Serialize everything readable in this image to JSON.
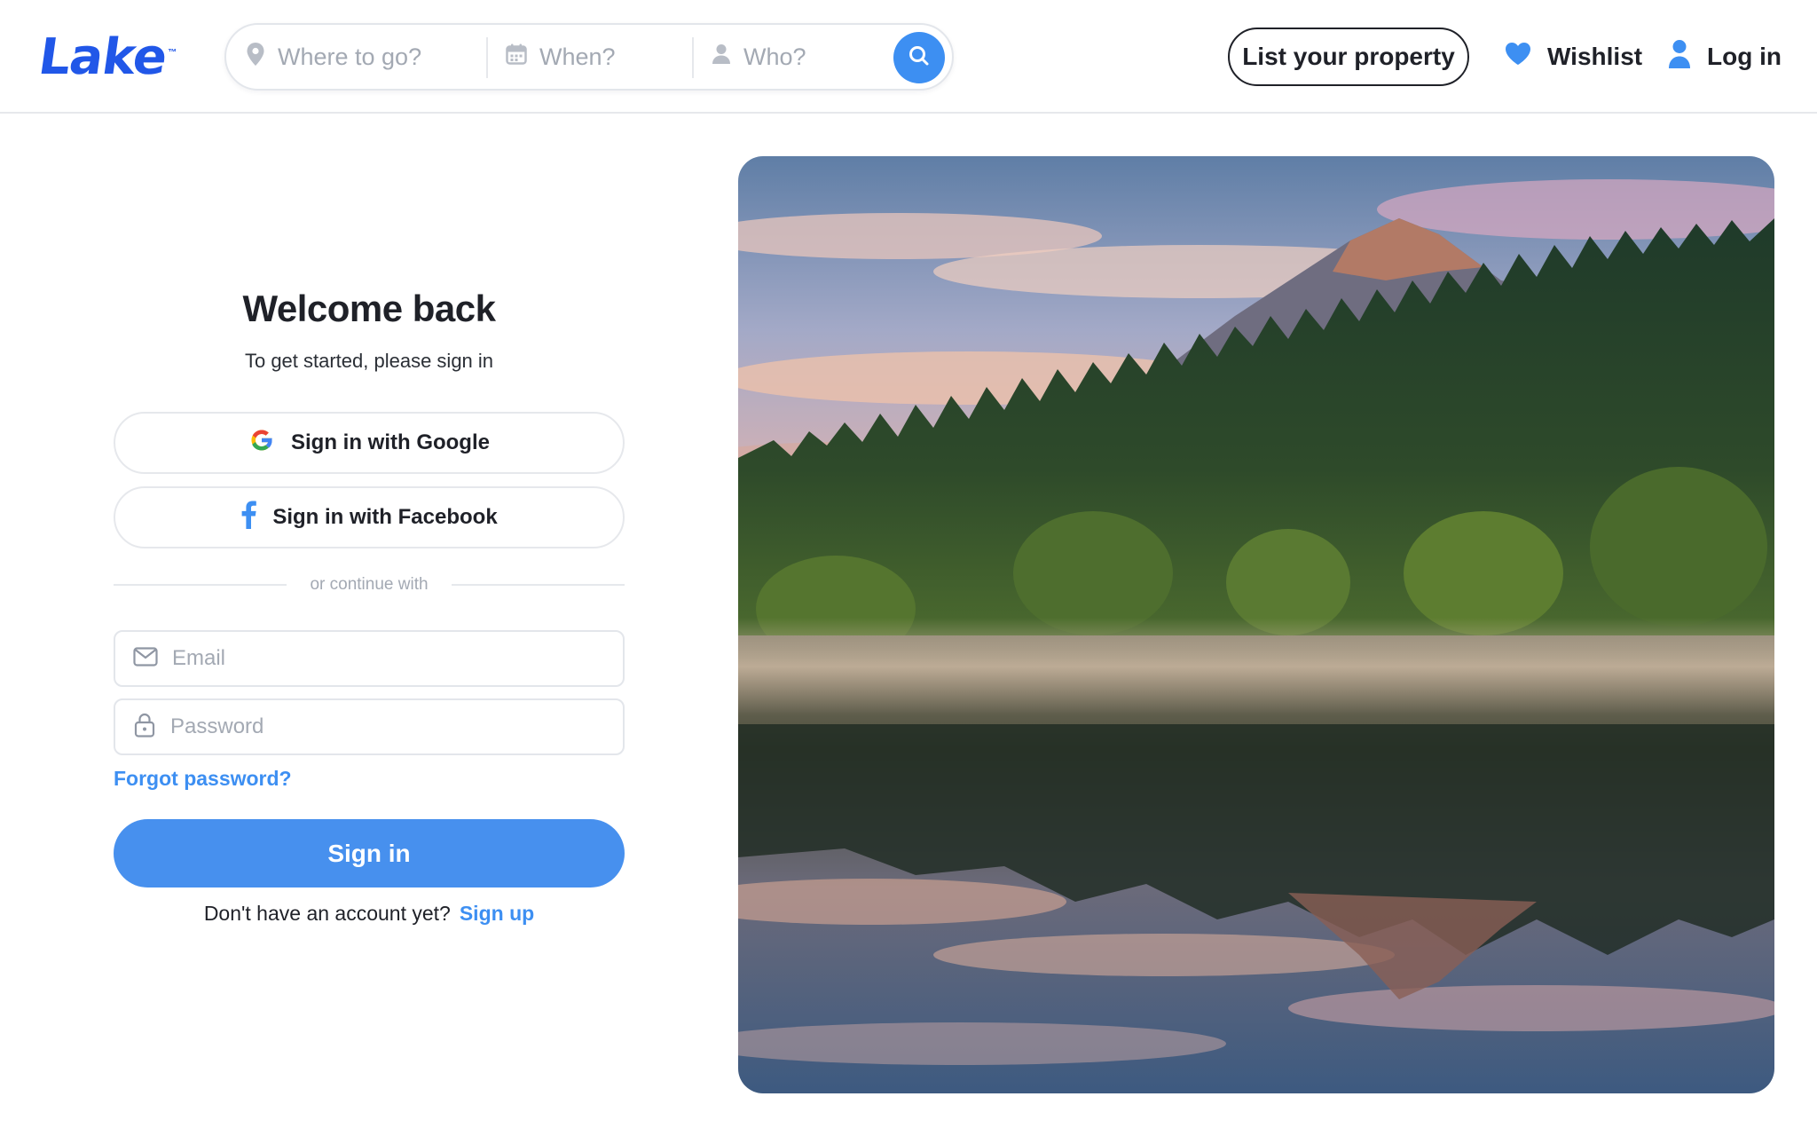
{
  "brand": {
    "name": "Lake",
    "trademark": "™",
    "color": "#2157e8"
  },
  "search": {
    "where_placeholder": "Where to go?",
    "when_placeholder": "When?",
    "who_placeholder": "Who?"
  },
  "nav": {
    "list_property": "List your property",
    "wishlist": "Wishlist",
    "login": "Log in"
  },
  "form": {
    "title": "Welcome back",
    "subtitle": "To get started, please sign in",
    "google_label": "Sign in with Google",
    "facebook_label": "Sign in with Facebook",
    "divider": "or continue with",
    "email_placeholder": "Email",
    "email_value": "",
    "password_placeholder": "Password",
    "password_value": "",
    "forgot": "Forgot password?",
    "submit": "Sign in",
    "no_account": "Don't have an account yet?",
    "signup": "Sign up"
  },
  "icons": {
    "where": "map-pin-icon",
    "when": "calendar-icon",
    "who": "user-icon",
    "search": "search-icon",
    "wishlist": "heart-icon",
    "login": "user-icon",
    "google": "google-icon",
    "facebook": "facebook-icon",
    "email": "mail-icon",
    "password": "lock-icon"
  },
  "colors": {
    "accent": "#3d8ff2",
    "primary_button": "#4790ee",
    "text": "#1f2128",
    "muted": "#a3a9b3",
    "border": "#e6e8ec"
  }
}
